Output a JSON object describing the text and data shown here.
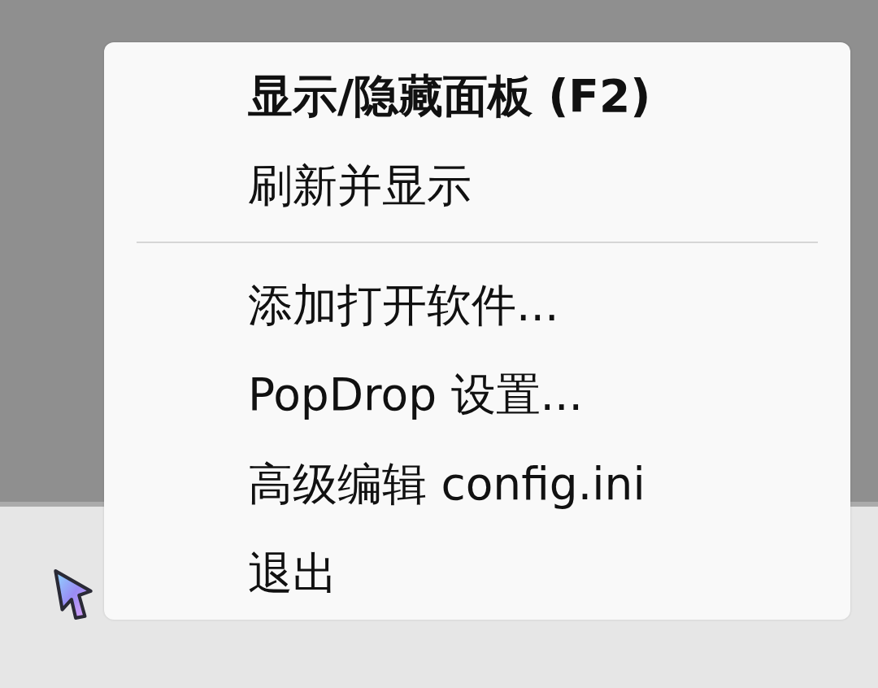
{
  "context_menu": {
    "items": [
      {
        "kind": "item",
        "label": "显示/隐藏面板 (F2)",
        "default": true
      },
      {
        "kind": "item",
        "label": "刷新并显示",
        "default": false
      },
      {
        "kind": "separator"
      },
      {
        "kind": "item",
        "label": "添加打开软件...",
        "default": false
      },
      {
        "kind": "item",
        "label": "PopDrop 设置...",
        "default": false
      },
      {
        "kind": "item",
        "label": "高级编辑 config.ini",
        "default": false
      },
      {
        "kind": "item",
        "label": "退出",
        "default": false
      }
    ]
  }
}
